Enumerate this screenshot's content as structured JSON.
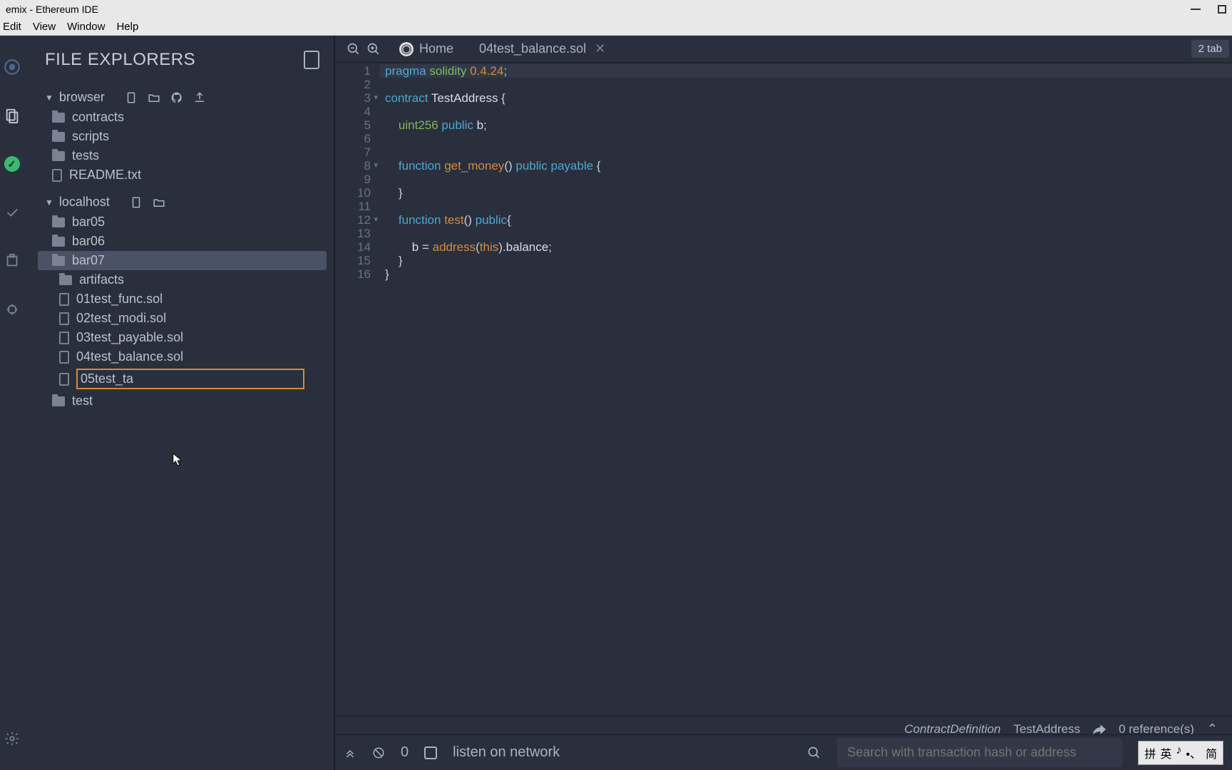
{
  "title": "emix - Ethereum IDE",
  "menu": [
    "Edit",
    "View",
    "Window",
    "Help"
  ],
  "panel_title": "FILE EXPLORERS",
  "workspaces": [
    {
      "name": "browser",
      "items": [
        {
          "type": "folder",
          "name": "contracts"
        },
        {
          "type": "folder",
          "name": "scripts"
        },
        {
          "type": "folder",
          "name": "tests"
        },
        {
          "type": "file",
          "name": "README.txt"
        }
      ]
    },
    {
      "name": "localhost",
      "items": [
        {
          "type": "folder",
          "name": "bar05"
        },
        {
          "type": "folder",
          "name": "bar06"
        },
        {
          "type": "folder",
          "name": "bar07",
          "selected": true,
          "children": [
            {
              "type": "folder",
              "name": "artifacts"
            },
            {
              "type": "file",
              "name": "01test_func.sol"
            },
            {
              "type": "file",
              "name": "02test_modi.sol"
            },
            {
              "type": "file",
              "name": "03test_payable.sol"
            },
            {
              "type": "file",
              "name": "04test_balance.sol"
            },
            {
              "type": "rename",
              "value": "05test_ta"
            }
          ]
        },
        {
          "type": "folder",
          "name": "test"
        }
      ]
    }
  ],
  "tabs": {
    "home": "Home",
    "open_file": "04test_balance.sol",
    "count": "2 tab"
  },
  "code_lines": [
    [
      {
        "c": "kw",
        "t": "pragma"
      },
      {
        "c": "punc",
        "t": " "
      },
      {
        "c": "type",
        "t": "solidity"
      },
      {
        "c": "punc",
        "t": " "
      },
      {
        "c": "num",
        "t": "0.4.24"
      },
      {
        "c": "punc",
        "t": ";"
      }
    ],
    [],
    [
      {
        "c": "kw",
        "t": "contract"
      },
      {
        "c": "punc",
        "t": " "
      },
      {
        "c": "ident",
        "t": "TestAddress"
      },
      {
        "c": "punc",
        "t": " {"
      }
    ],
    [],
    [
      {
        "c": "punc",
        "t": "    "
      },
      {
        "c": "type",
        "t": "uint256"
      },
      {
        "c": "punc",
        "t": " "
      },
      {
        "c": "kw",
        "t": "public"
      },
      {
        "c": "punc",
        "t": " "
      },
      {
        "c": "ident",
        "t": "b"
      },
      {
        "c": "punc",
        "t": ";"
      }
    ],
    [],
    [],
    [
      {
        "c": "punc",
        "t": "    "
      },
      {
        "c": "kw",
        "t": "function"
      },
      {
        "c": "punc",
        "t": " "
      },
      {
        "c": "fn",
        "t": "get_money"
      },
      {
        "c": "punc",
        "t": "() "
      },
      {
        "c": "kw",
        "t": "public"
      },
      {
        "c": "punc",
        "t": " "
      },
      {
        "c": "kw",
        "t": "payable"
      },
      {
        "c": "punc",
        "t": " {"
      }
    ],
    [],
    [
      {
        "c": "punc",
        "t": "    }"
      }
    ],
    [],
    [
      {
        "c": "punc",
        "t": "    "
      },
      {
        "c": "kw",
        "t": "function"
      },
      {
        "c": "punc",
        "t": " "
      },
      {
        "c": "fn",
        "t": "test"
      },
      {
        "c": "punc",
        "t": "() "
      },
      {
        "c": "kw",
        "t": "public"
      },
      {
        "c": "punc",
        "t": "{"
      }
    ],
    [],
    [
      {
        "c": "punc",
        "t": "        "
      },
      {
        "c": "ident",
        "t": "b"
      },
      {
        "c": "punc",
        "t": " = "
      },
      {
        "c": "fn",
        "t": "address"
      },
      {
        "c": "punc",
        "t": "("
      },
      {
        "c": "kwthis",
        "t": "this"
      },
      {
        "c": "punc",
        "t": ")."
      },
      {
        "c": "ident",
        "t": "balance"
      },
      {
        "c": "punc",
        "t": ";"
      }
    ],
    [
      {
        "c": "punc",
        "t": "    }"
      }
    ],
    [
      {
        "c": "punc",
        "t": "}"
      }
    ]
  ],
  "fold_lines": [
    3,
    8,
    12
  ],
  "status": {
    "def_type": "ContractDefinition",
    "def_name": "TestAddress",
    "refs": "0 reference(s)"
  },
  "terminal": {
    "count": "0",
    "listen": "listen on network",
    "search_placeholder": "Search with transaction hash or address"
  },
  "ime": [
    "拼",
    "英",
    "♪",
    "•、",
    "简"
  ]
}
